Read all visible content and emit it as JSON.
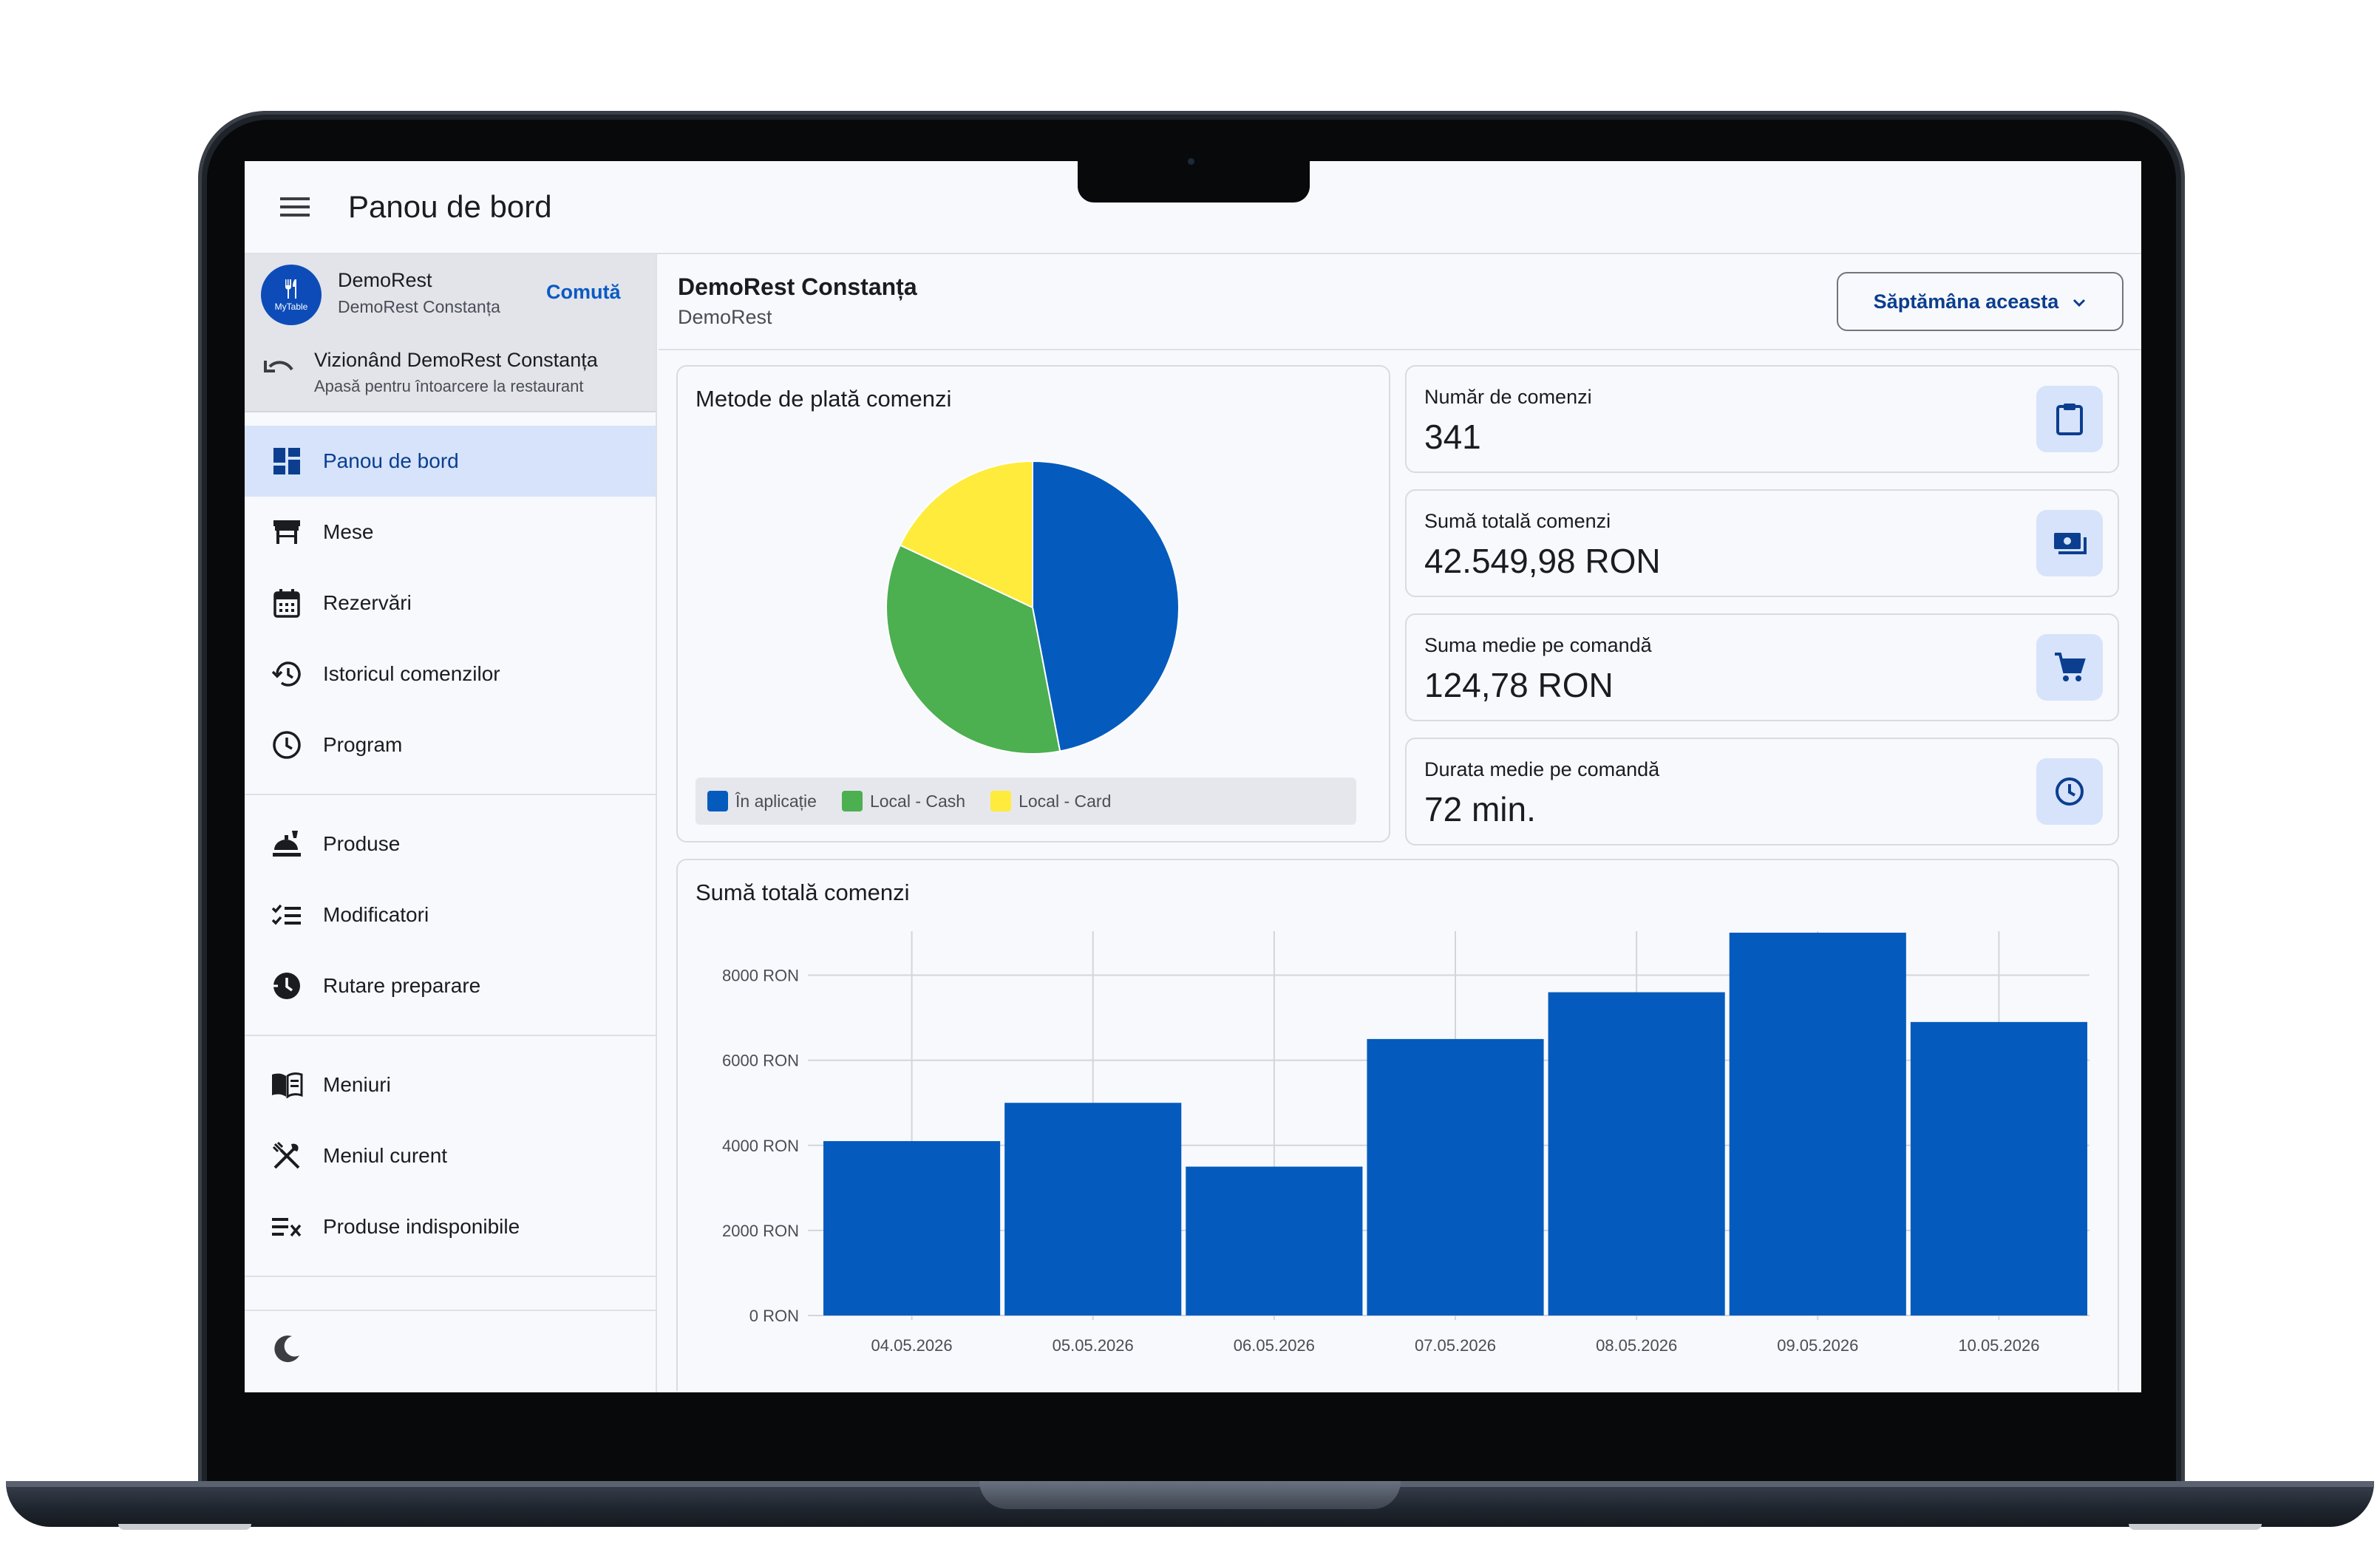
{
  "app": {
    "page_title": "Panou de bord"
  },
  "restaurant": {
    "logo_text": "MyTable",
    "name": "DemoRest",
    "location": "DemoRest Constanța",
    "switch_label": "Comută",
    "viewing_title": "Vizionând DemoRest Constanța",
    "viewing_sub": "Apasă pentru întoarcere la restaurant"
  },
  "sidebar": {
    "groups": [
      [
        {
          "label": "Panou de bord",
          "icon": "dashboard-icon",
          "active": true
        },
        {
          "label": "Mese",
          "icon": "table-icon"
        },
        {
          "label": "Rezervări",
          "icon": "calendar-icon"
        },
        {
          "label": "Istoricul comenzilor",
          "icon": "history-icon"
        },
        {
          "label": "Program",
          "icon": "clock-icon"
        }
      ],
      [
        {
          "label": "Produse",
          "icon": "food-icon"
        },
        {
          "label": "Modificatori",
          "icon": "checklist-icon"
        },
        {
          "label": "Rutare preparare",
          "icon": "timer-icon"
        }
      ],
      [
        {
          "label": "Meniuri",
          "icon": "menu-book-icon"
        },
        {
          "label": "Meniul curent",
          "icon": "cutlery-icon"
        },
        {
          "label": "Produse indisponibile",
          "icon": "unavailable-icon"
        }
      ]
    ]
  },
  "main": {
    "title": "DemoRest Constanța",
    "subtitle": "DemoRest",
    "period": "Săptămâna aceasta"
  },
  "payment_card": {
    "title": "Metode de plată comenzi"
  },
  "stats": [
    {
      "label": "Număr de comenzi",
      "value": "341",
      "icon": "clipboard-icon"
    },
    {
      "label": "Sumă totală comenzi",
      "value": "42.549,98 RON",
      "icon": "cash-icon"
    },
    {
      "label": "Suma medie pe comandă",
      "value": "124,78 RON",
      "icon": "cart-icon"
    },
    {
      "label": "Durata medie pe comandă",
      "value": "72 min.",
      "icon": "clock-icon"
    }
  ],
  "colors": {
    "primary": "#0a5ac2",
    "bar": "#045bbd",
    "app": "#045bbd",
    "cash": "#4caf50",
    "card": "#ffeb3b"
  },
  "chart_data": [
    {
      "type": "pie",
      "title": "Metode de plată comenzi",
      "labels": [
        "În aplicație",
        "Local - Cash",
        "Local - Card"
      ],
      "values": [
        47,
        35,
        18
      ],
      "colors": [
        "#045bbd",
        "#4caf50",
        "#ffeb3b"
      ],
      "legend": "bottom"
    },
    {
      "type": "bar",
      "title": "Sumă totală comenzi",
      "categories": [
        "04.05.2026",
        "05.05.2026",
        "06.05.2026",
        "07.05.2026",
        "08.05.2026",
        "09.05.2026",
        "10.05.2026"
      ],
      "values": [
        4100,
        5000,
        3500,
        6500,
        7600,
        9000,
        6900
      ],
      "yticks": [
        "0 RON",
        "2000 RON",
        "4000 RON",
        "6000 RON",
        "8000 RON"
      ],
      "ylim": [
        0,
        9000
      ],
      "grid": true
    }
  ]
}
